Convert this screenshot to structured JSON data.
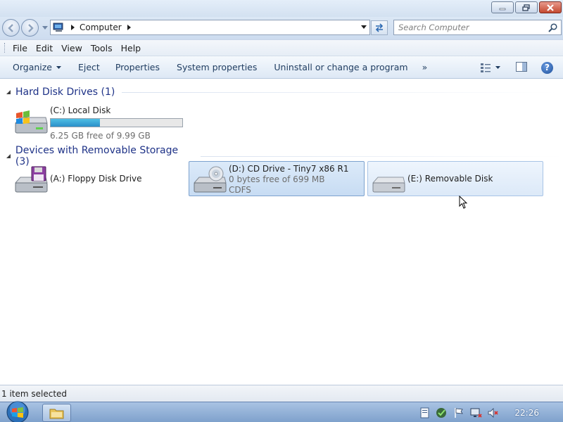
{
  "window": {
    "minimize_label": "Minimize",
    "maximize_label": "Maximize",
    "close_label": "Close"
  },
  "address": {
    "breadcrumb": "Computer",
    "search_placeholder": "Search Computer"
  },
  "menu": {
    "items": [
      "File",
      "Edit",
      "View",
      "Tools",
      "Help"
    ]
  },
  "commands": {
    "organize": "Organize",
    "eject": "Eject",
    "properties": "Properties",
    "system_properties": "System properties",
    "uninstall": "Uninstall or change a program",
    "more": "»"
  },
  "groups": [
    {
      "title": "Hard Disk Drives (1)",
      "items": [
        {
          "name": "(C:) Local Disk",
          "free_text": "6.25 GB free of 9.99 GB",
          "used_fraction": 0.374,
          "icon": "hard-disk-icon"
        }
      ]
    },
    {
      "title": "Devices with Removable Storage (3)",
      "items": [
        {
          "name": "(A:) Floppy Disk Drive",
          "icon": "floppy-drive-icon"
        },
        {
          "name": "(D:) CD Drive - Tiny7 x86 R1",
          "free_text": "0 bytes free of 699 MB",
          "fs": "CDFS",
          "icon": "cd-drive-icon",
          "selected": true
        },
        {
          "name": "(E:) Removable Disk",
          "icon": "removable-disk-icon",
          "hovered": true
        }
      ]
    }
  ],
  "status": {
    "text": "1 item selected"
  },
  "taskbar": {
    "clock": "22:26"
  },
  "colors": {
    "group_title": "#1e3287",
    "capacity_fill": "#2a8fc9",
    "selection": "#c7dcf3"
  }
}
